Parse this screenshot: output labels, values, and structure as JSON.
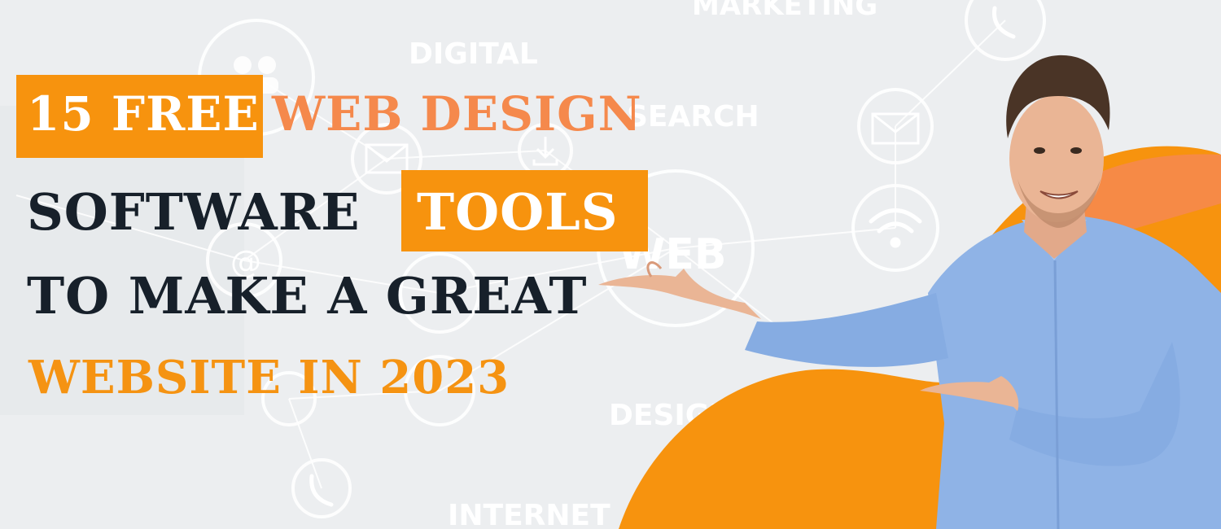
{
  "headline": {
    "line1_box": "15 FREE",
    "line1_rest": "WEB DESIGN",
    "line2_plain": "SOFTWARE",
    "line2_box": "TOOLS",
    "line3": "TO MAKE A GREAT",
    "line4": "WEBSITE IN 2023"
  },
  "background_words": {
    "marketing": "MARKETING",
    "digital": "DIGITAL",
    "search": "SEARCH",
    "web": "WEB",
    "design": "DESIGN",
    "internet": "INTERNET"
  },
  "colors": {
    "accent_orange": "#f7930e",
    "text_dark": "#17202a",
    "text_salmon": "#f5894c",
    "shirt_blue": "#8fb3e6"
  },
  "icons": [
    "users-icon",
    "envelope-icon",
    "download-icon",
    "at-sign-icon",
    "phone-icon",
    "wifi-icon",
    "network-node-icon"
  ]
}
